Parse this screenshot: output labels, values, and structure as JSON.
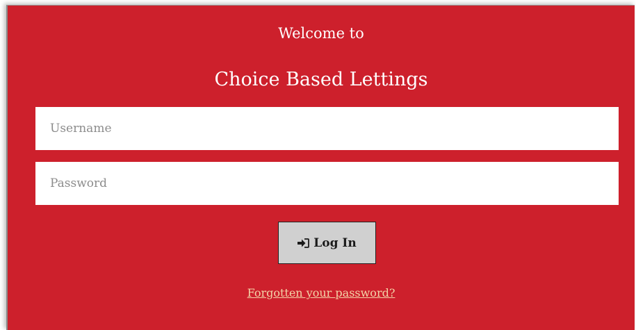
{
  "header": {
    "welcome": "Welcome to",
    "title": "Choice Based Lettings"
  },
  "form": {
    "username_placeholder": "Username",
    "password_placeholder": "Password",
    "login_label": "Log In",
    "login_icon": "sign-in-icon",
    "forgot_password": "Forgotten your password?"
  },
  "colors": {
    "panel_background": "#cd202c",
    "button_background": "#d0d0d0",
    "link": "#f3d4a8"
  }
}
